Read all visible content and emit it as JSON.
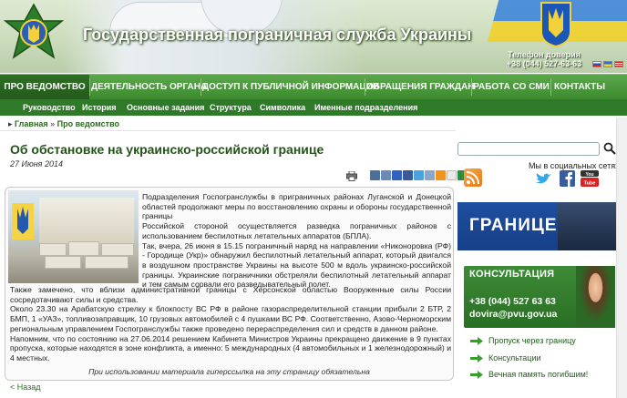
{
  "header": {
    "site_title": "Государственная пограничная служба Украины",
    "hotline_label": "Телефон доверия",
    "hotline_number": "+38 (044) 527-63-63"
  },
  "nav": {
    "items": [
      {
        "label": "ПРО ВЕДОМСТВО"
      },
      {
        "label": "ДЕЯТЕЛЬНОСТЬ ОРГАНА"
      },
      {
        "label": "ДОСТУП К ПУБЛИЧНОЙ ИНФОРМАЦИИ"
      },
      {
        "label": "ОБРАЩЕНИЯ ГРАЖДАН"
      },
      {
        "label": "РАБОТА СО СМИ"
      },
      {
        "label": "КОНТАКТЫ"
      }
    ]
  },
  "subnav": {
    "items": [
      {
        "label": "Руководство"
      },
      {
        "label": "История"
      },
      {
        "label": "Основные задания"
      },
      {
        "label": "Структура"
      },
      {
        "label": "Символика"
      },
      {
        "label": "Именные подразделения"
      }
    ]
  },
  "breadcrumb": {
    "home": "Главная",
    "separator": " » ",
    "current": "Про ведомство"
  },
  "article": {
    "title": "Об обстановке на украинско-российской границе",
    "date": "27 Июня 2014",
    "para_side": "Подразделения Госпогранслужбы в приграничных районах Луганской и Донецкой областей продолжают меры по восстановлению охраны и обороны государственной границы\nРоссийской стороной осуществляется разведка пограничных районов с использованием беспилотных летательных аппаратов (БПЛА).\nТак, вчера, 26 июня в 15.15 пограничный наряд на направлении «Никоноровка (РФ) - Городище (Укр)» обнаружил беспилотный летательный аппарат, который двигался в воздушном пространстве Украины на высоте 500 м вдоль украинско-российской границы.  Украинские пограничники обстреляли беспилотный летательный аппарат и тем самым сорвали его разведывательный полет.",
    "para_full": "Также замечено, что вблизи административной границы с Херсонской областью Вооруженные силы России сосредотачивают силы и средства.\nОколо 23.30 на Арабатскую стрелку к блокпосту ВС РФ в районе газораспределительной станции прибыли 2 БТР, 2 БМП, 1 «УАЗ», топливозаправщик, 10 грузовых автомобилей с 4 пушками ВС РФ. Соответственно, Азово-Черноморским региональным управлением Госпогранслужбы также проведено перераспределения сил и средств в данном районе.\nНапомним, что по состоянию на 27.06.2014 решением Кабинета Министров Украины прекращено движение в 9 пунктах пропуска, которые находятся в зоне конфликта, а именно: 5 международных (4 автомобильных и 1 железнодорожный) и 4 местных.",
    "quote": "При использовании материала гиперссылка на эту страницу обязательна",
    "back": "< Назад"
  },
  "sidebar": {
    "social_label": "Мы в социальных сетях",
    "banner_text": "ГРАНИЦЕ",
    "consult": {
      "title": "КОНСУЛЬТАЦИЯ",
      "phone": "+38 (044) 527 63 63",
      "email": "dovira@pvu.gov.ua"
    },
    "links": [
      {
        "label": "Пропуск через границу"
      },
      {
        "label": "Консультации"
      },
      {
        "label": "Вечная память погибшим!"
      }
    ]
  },
  "colors": {
    "nav_green": "#3d8a30",
    "nav_active": "#245a1c",
    "subnav": "#2f7a28",
    "title_green": "#24521b",
    "banner_blue": "#1f4fa0"
  }
}
